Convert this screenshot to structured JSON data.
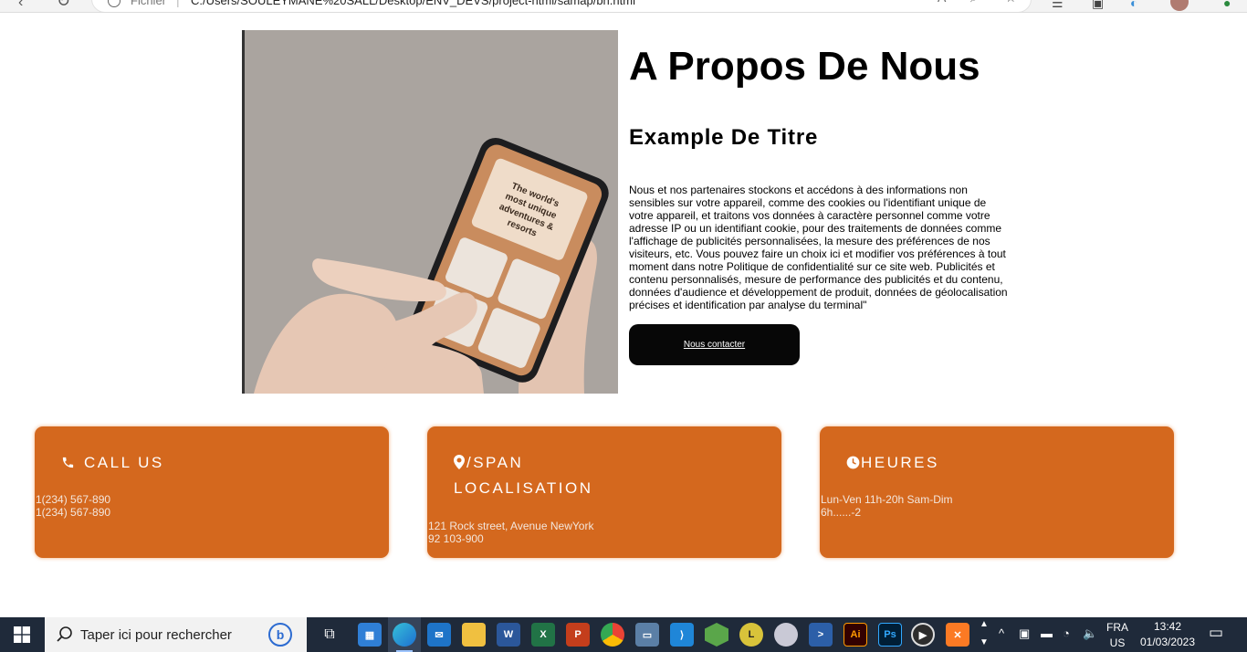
{
  "browser": {
    "scheme_label": "Fichier",
    "separator": "|",
    "url": "C:/Users/SOULEYMANE%20SALL/Desktop/ENV_DEVS/project-html/samap/bh.html"
  },
  "about": {
    "image_alt": "Hands holding a smartphone showing The world's most unique adventures & resorts",
    "phone_screen_text": "The world's most unique adventures & resorts",
    "title": "A Propos De Nous",
    "subtitle": "Example De Titre",
    "text": "Nous et nos partenaires stockons et accédons à des informations non sensibles sur votre appareil, comme des cookies ou l'identifiant unique de votre appareil, et traitons vos données à caractère personnel comme votre adresse IP ou un identifiant cookie, pour des traitements de données comme l'affichage de publicités personnalisées, la mesure des préférences de nos visiteurs, etc. Vous pouvez faire un choix ici et modifier vos préférences à tout moment dans notre Politique de confidentialité sur ce site web. Publicités et contenu personnalisés, mesure de performance des publicités et du contenu, données d'audience et développement de produit, données de géolocalisation précises et identification par analyse du terminal\"",
    "button_label": "Nous contacter"
  },
  "cards": {
    "call": {
      "icon": "phone-icon",
      "heading": "CALL US",
      "line1": "1(234) 567-890",
      "line2": "1(234) 567-890"
    },
    "location": {
      "icon": "map-pin-icon",
      "heading_line1": "/SPAN",
      "heading_line2": "LOCALISATION",
      "line1": "121 Rock street, Avenue NewYork",
      "line2": "92 103-900"
    },
    "hours": {
      "icon": "clock-icon",
      "heading": "HEURES",
      "line1": "Lun-Ven 11h-20h Sam-Dim",
      "line2": "6h......-2"
    }
  },
  "colors": {
    "card_bg": "#d4681e",
    "button_bg": "#070707",
    "taskbar_bg": "#1f2a3a"
  },
  "taskbar": {
    "search_placeholder": "Taper ici pour rechercher",
    "apps": [
      "task-view",
      "microsoft-store",
      "edge",
      "mail",
      "file-explorer",
      "word",
      "excel",
      "powerpoint",
      "chrome",
      "remote-desktop",
      "vscode",
      "nodejs",
      "app-yellow",
      "app-network",
      "powershell",
      "illustrator",
      "photoshop",
      "media-player",
      "xampp"
    ],
    "language_top": "FRA",
    "language_bottom": "US",
    "time": "13:42",
    "date": "01/03/2023"
  }
}
